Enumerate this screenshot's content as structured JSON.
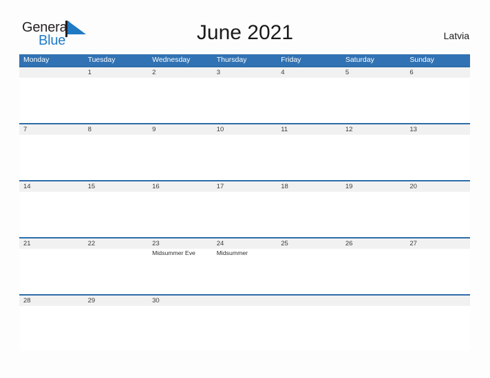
{
  "brand": {
    "name_part1": "General",
    "name_part2": "Blue",
    "flag_icon": "blue-triangle-flag-icon",
    "color_dark": "#231f20",
    "color_blue": "#1f7ac4"
  },
  "header": {
    "title": "June 2021",
    "country": "Latvia"
  },
  "colors": {
    "header_blue": "#3072b3",
    "rule_blue": "#2b6ca8",
    "date_band": "#f1f1f1",
    "cell_white": "#ffffff",
    "page_background": "#fdfdfd"
  },
  "calendar": {
    "month": "June",
    "year": "2021",
    "weekday_headers": [
      "Monday",
      "Tuesday",
      "Wednesday",
      "Thursday",
      "Friday",
      "Saturday",
      "Sunday"
    ],
    "weeks": [
      {
        "days": [
          {
            "date": "",
            "events": []
          },
          {
            "date": "1",
            "events": []
          },
          {
            "date": "2",
            "events": []
          },
          {
            "date": "3",
            "events": []
          },
          {
            "date": "4",
            "events": []
          },
          {
            "date": "5",
            "events": []
          },
          {
            "date": "6",
            "events": []
          }
        ]
      },
      {
        "days": [
          {
            "date": "7",
            "events": []
          },
          {
            "date": "8",
            "events": []
          },
          {
            "date": "9",
            "events": []
          },
          {
            "date": "10",
            "events": []
          },
          {
            "date": "11",
            "events": []
          },
          {
            "date": "12",
            "events": []
          },
          {
            "date": "13",
            "events": []
          }
        ]
      },
      {
        "days": [
          {
            "date": "14",
            "events": []
          },
          {
            "date": "15",
            "events": []
          },
          {
            "date": "16",
            "events": []
          },
          {
            "date": "17",
            "events": []
          },
          {
            "date": "18",
            "events": []
          },
          {
            "date": "19",
            "events": []
          },
          {
            "date": "20",
            "events": []
          }
        ]
      },
      {
        "days": [
          {
            "date": "21",
            "events": []
          },
          {
            "date": "22",
            "events": []
          },
          {
            "date": "23",
            "events": [
              "Midsummer Eve"
            ]
          },
          {
            "date": "24",
            "events": [
              "Midsummer"
            ]
          },
          {
            "date": "25",
            "events": []
          },
          {
            "date": "26",
            "events": []
          },
          {
            "date": "27",
            "events": []
          }
        ]
      },
      {
        "days": [
          {
            "date": "28",
            "events": []
          },
          {
            "date": "29",
            "events": []
          },
          {
            "date": "30",
            "events": []
          },
          {
            "date": "",
            "events": []
          },
          {
            "date": "",
            "events": []
          },
          {
            "date": "",
            "events": []
          },
          {
            "date": "",
            "events": []
          }
        ]
      }
    ]
  }
}
